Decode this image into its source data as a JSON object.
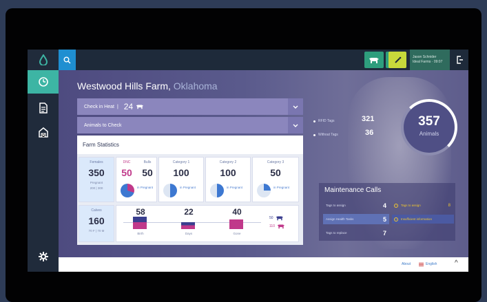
{
  "sidebar": {
    "logo_icon": "drop-logo-icon",
    "items": [
      {
        "icon": "dashboard-icon",
        "active": true
      },
      {
        "icon": "document-icon",
        "active": false
      },
      {
        "icon": "barn-icon",
        "active": false
      }
    ],
    "settings_icon": "gear-icon"
  },
  "topbar": {
    "search_icon": "search-icon",
    "icons": [
      {
        "name": "cow-icon",
        "color": "#2e9e7d"
      },
      {
        "name": "syringe-icon",
        "color": "#2e9e7d"
      },
      {
        "name": "wand-icon",
        "color": "#c7d93b"
      }
    ],
    "user_name": "Jason Schnider",
    "user_sub": "Ideal Farms · 09:07",
    "logout_icon": "logout-icon"
  },
  "main": {
    "farm_name": "Westwood Hills Farm,",
    "farm_state": "Oklahoma",
    "check_heat": {
      "label": "Check in Heat",
      "value": "24"
    },
    "animals_to_check": {
      "label": "Animals to Check"
    },
    "farm_statistics_label": "Farm Statistics",
    "stats": {
      "females": {
        "label": "Females",
        "value": "350",
        "sub1": "Pregnant",
        "sub2": "200 | 300"
      },
      "calves": {
        "label": "Calves",
        "value": "160",
        "sub": "70 F | 70 M"
      },
      "dnc": {
        "label": "DNC",
        "value": "50"
      },
      "bulls": {
        "label": "Bulls",
        "value": "50"
      },
      "cat1": {
        "label": "Category 1",
        "value": "100"
      },
      "cat2": {
        "label": "Category 2",
        "value": "100"
      },
      "cat3": {
        "label": "Category 3",
        "value": "50"
      },
      "pie_label": "in Pregnant",
      "bars": [
        {
          "value": "58",
          "label": "Birth"
        },
        {
          "value": "22",
          "label": "Days"
        },
        {
          "value": "40",
          "label": "Gone"
        }
      ],
      "bulls_count": "50",
      "cows_count": "110"
    },
    "tags": [
      {
        "label": "RFID Tags",
        "value": "321"
      },
      {
        "label": "Without Tags",
        "value": "36"
      }
    ],
    "animals_total": {
      "value": "357",
      "label": "Animals"
    },
    "maintenance": {
      "title": "Maintenance Calls",
      "rows": [
        {
          "label": "Tags to assign",
          "value": "4"
        },
        {
          "label": "Assign Health Tasks",
          "value": "5"
        },
        {
          "label": "Tags to replace",
          "value": "7"
        }
      ],
      "warnings": [
        {
          "label": "Tags to assign",
          "count": "8"
        },
        {
          "label": "Insufficient information",
          "count": ""
        }
      ]
    }
  },
  "footer": {
    "about": "About",
    "language": "English",
    "up_icon": "chevron-up-icon"
  },
  "colors": {
    "accent_teal": "#3db5a4",
    "accent_blue": "#1f8fd1",
    "warning_yellow": "#f0c630",
    "bar_magenta": "#c0398a",
    "bar_navy": "#3a3f8f"
  }
}
